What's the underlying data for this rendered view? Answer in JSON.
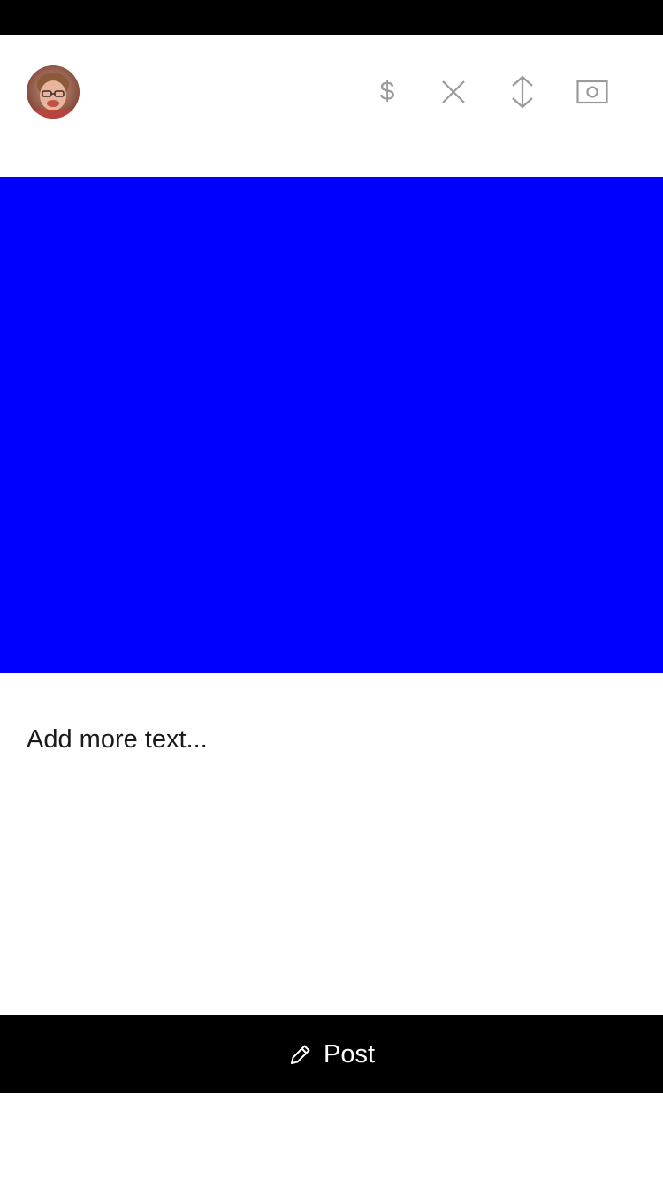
{
  "status_bar": {
    "color": "#000000"
  },
  "header": {
    "avatar": {
      "icon": "avatar"
    },
    "actions": [
      {
        "id": "dollar",
        "icon": "dollar-icon",
        "glyph": "$"
      },
      {
        "id": "close",
        "icon": "close-icon"
      },
      {
        "id": "resize",
        "icon": "vertical-resize-icon"
      },
      {
        "id": "camera",
        "icon": "camera-icon"
      }
    ],
    "icon_color": "#9a9a9a"
  },
  "media": {
    "color": "#0000ff"
  },
  "composer": {
    "text": "Add more text..."
  },
  "post_button": {
    "label": "Post",
    "icon": "pencil-icon",
    "background": "#000000",
    "text_color": "#ffffff"
  }
}
